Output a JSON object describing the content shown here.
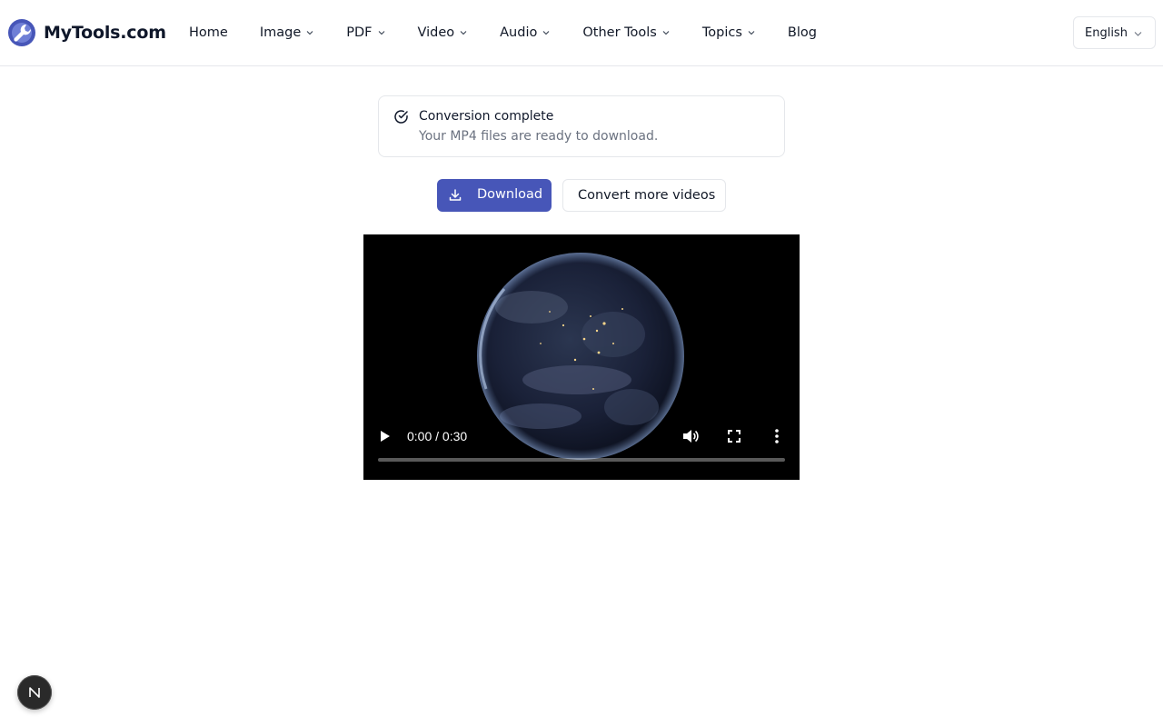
{
  "header": {
    "brand": "MyTools.com",
    "nav": [
      {
        "label": "Home",
        "dropdown": false
      },
      {
        "label": "Image",
        "dropdown": true
      },
      {
        "label": "PDF",
        "dropdown": true
      },
      {
        "label": "Video",
        "dropdown": true
      },
      {
        "label": "Audio",
        "dropdown": true
      },
      {
        "label": "Other Tools",
        "dropdown": true
      },
      {
        "label": "Topics",
        "dropdown": true
      },
      {
        "label": "Blog",
        "dropdown": false
      }
    ],
    "language": "English"
  },
  "alert": {
    "title": "Conversion complete",
    "description": "Your MP4 files are ready to download."
  },
  "actions": {
    "download_label": "Download",
    "convert_more_label": "Convert more videos"
  },
  "video": {
    "time": "0:00 / 0:30",
    "progress": 0
  },
  "colors": {
    "primary": "#4756b8",
    "border": "#e5e7eb",
    "muted_text": "#6b7280",
    "video_bg": "#000000"
  },
  "icons": {
    "logo": "wrench-circle-icon",
    "alert": "check-circle-icon",
    "download": "download-icon",
    "play": "play-icon",
    "volume": "volume-icon",
    "fullscreen": "fullscreen-icon",
    "more": "more-vertical-icon",
    "bubble": "n-logo-icon"
  }
}
